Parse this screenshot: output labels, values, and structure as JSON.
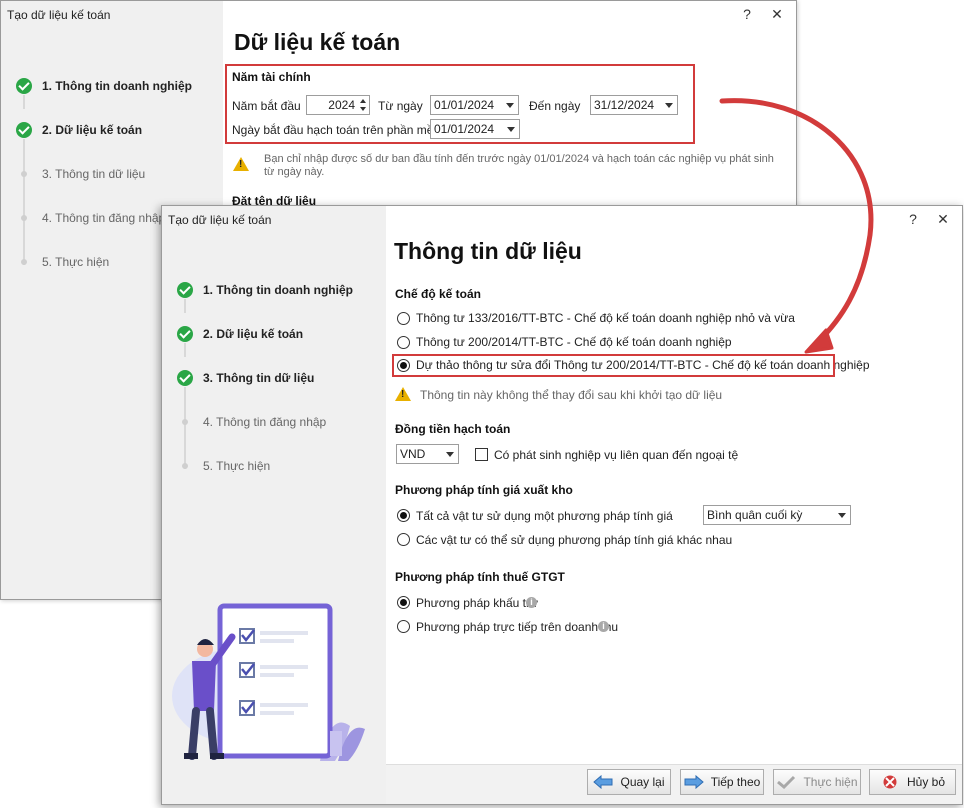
{
  "back_window": {
    "title": "Tạo dữ liệu kế toán",
    "help": "?",
    "close": "✕",
    "steps": [
      {
        "label": "1. Thông tin doanh nghiệp",
        "state": "done"
      },
      {
        "label": "2. Dữ liệu kế toán",
        "state": "done"
      },
      {
        "label": "3. Thông tin dữ liệu",
        "state": "todo"
      },
      {
        "label": "4. Thông tin đăng nhập",
        "state": "todo"
      },
      {
        "label": "5. Thực hiện",
        "state": "todo"
      }
    ],
    "page_title": "Dữ liệu kế toán",
    "fiscal_year": {
      "section_title": "Năm tài chính",
      "start_year_label": "Năm bắt đầu",
      "start_year_value": "2024",
      "from_label": "Từ ngày",
      "from_value": "01/01/2024",
      "to_label": "Đến ngày",
      "to_value": "31/12/2024",
      "software_start_label": "Ngày bắt đầu hạch toán trên phần mềm",
      "software_start_value": "01/01/2024"
    },
    "warning_line1": "Bạn chỉ nhập được số dư ban đầu tính đến trước ngày 01/01/2024 và hạch toán các nghiệp vụ phát sinh",
    "warning_line2": "từ ngày này.",
    "next_section_title": "Đặt tên dữ liệu"
  },
  "front_window": {
    "title": "Tạo dữ liệu kế toán",
    "help": "?",
    "close": "✕",
    "steps": [
      {
        "label": "1. Thông tin doanh nghiệp",
        "state": "done"
      },
      {
        "label": "2. Dữ liệu kế toán",
        "state": "done"
      },
      {
        "label": "3. Thông tin dữ liệu",
        "state": "done"
      },
      {
        "label": "4. Thông tin đăng nhập",
        "state": "todo"
      },
      {
        "label": "5. Thực hiện",
        "state": "todo"
      }
    ],
    "page_title": "Thông tin dữ liệu",
    "regime": {
      "section_title": "Chế độ kế toán",
      "options": [
        "Thông tư 133/2016/TT-BTC - Chế độ kế toán doanh nghiệp nhỏ và vừa",
        "Thông tư 200/2014/TT-BTC - Chế độ kế toán doanh nghiệp",
        "Dự thảo thông tư sửa đổi Thông tư 200/2014/TT-BTC - Chế độ kế toán doanh nghiệp"
      ],
      "selected": 2,
      "note": "Thông tin này không thể thay đổi sau khi khởi tạo dữ liệu"
    },
    "currency": {
      "section_title": "Đồng tiền hạch toán",
      "value": "VND",
      "foreign_checkbox_label": "Có phát sinh nghiệp vụ liên quan đến ngoại tệ"
    },
    "inventory": {
      "section_title": "Phương pháp tính giá xuất kho",
      "option_all": "Tất cả vật tư sử dụng một phương pháp tính giá",
      "option_multi": "Các vật tư có thể sử dụng phương pháp tính giá khác nhau",
      "method_value": "Bình quân cuối kỳ"
    },
    "vat": {
      "section_title": "Phương pháp tính thuế GTGT",
      "option_deduct": "Phương pháp khấu trừ",
      "option_direct": "Phương pháp trực tiếp trên doanh thu"
    },
    "buttons": {
      "back": "Quay lại",
      "next": "Tiếp theo",
      "execute": "Thực hiện",
      "cancel": "Hủy bỏ"
    }
  },
  "colors": {
    "highlight": "#d23b3b",
    "check_green": "#2aa646",
    "illustration_purple": "#7563d6"
  }
}
